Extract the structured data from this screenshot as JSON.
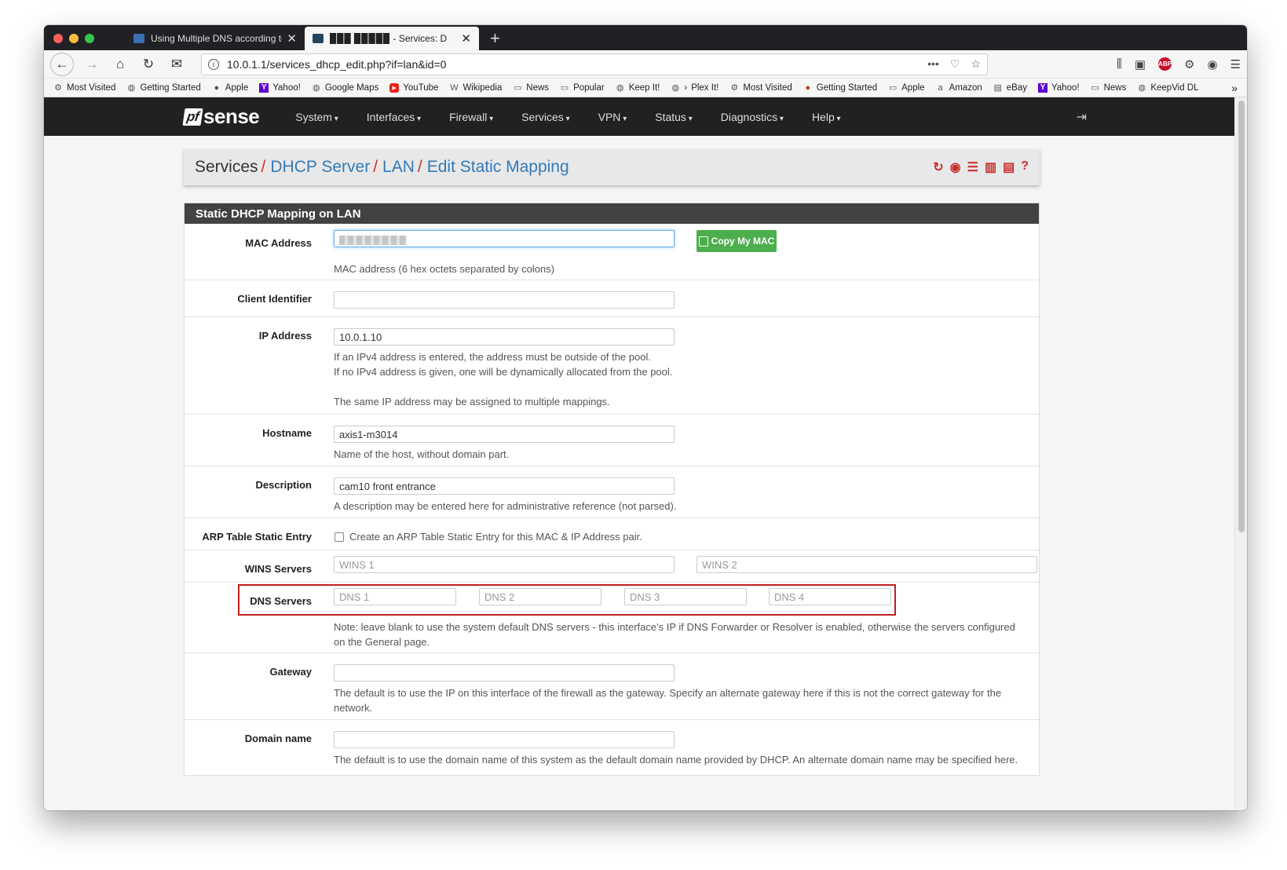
{
  "browser": {
    "tabs": [
      {
        "title": "Using Multiple DNS according to"
      },
      {
        "title": "▉▉▉ ▉▉▉▉▉ - Services: D"
      }
    ],
    "url": "10.0.1.1/services_dhcp_edit.php?if=lan&id=0",
    "bookmarks": [
      "Most Visited",
      "Getting Started",
      "Apple",
      "Yahoo!",
      "Google Maps",
      "YouTube",
      "Wikipedia",
      "News",
      "Popular",
      "Keep It!",
      "Plex It!",
      "Most Visited",
      "Getting Started",
      "Apple",
      "Amazon",
      "eBay",
      "Yahoo!",
      "News",
      "KeepVid DL"
    ]
  },
  "app": {
    "logo_pf": "pf",
    "logo_text": "sense",
    "menu": [
      "System",
      "Interfaces",
      "Firewall",
      "Services",
      "VPN",
      "Status",
      "Diagnostics",
      "Help"
    ]
  },
  "breadcrumb": {
    "root": "Services",
    "links": [
      "DHCP Server",
      "LAN",
      "Edit Static Mapping"
    ]
  },
  "panel": {
    "title": "Static DHCP Mapping on LAN"
  },
  "form": {
    "mac": {
      "label": "MAC Address",
      "button": "Copy My MAC",
      "help": "MAC address (6 hex octets separated by colons)"
    },
    "client_id": {
      "label": "Client Identifier",
      "value": ""
    },
    "ip": {
      "label": "IP Address",
      "value": "10.0.1.10",
      "help1": "If an IPv4 address is entered, the address must be outside of the pool.",
      "help2": "If no IPv4 address is given, one will be dynamically allocated from the pool.",
      "help3": "The same IP address may be assigned to multiple mappings."
    },
    "hostname": {
      "label": "Hostname",
      "value": "axis1-m3014",
      "help": "Name of the host, without domain part."
    },
    "description": {
      "label": "Description",
      "value": "cam10 front entrance",
      "help": "A description may be entered here for administrative reference (not parsed)."
    },
    "arp": {
      "label": "ARP Table Static Entry",
      "text": "Create an ARP Table Static Entry for this MAC & IP Address pair."
    },
    "wins": {
      "label": "WINS Servers",
      "ph1": "WINS 1",
      "ph2": "WINS 2"
    },
    "dns": {
      "label": "DNS Servers",
      "ph1": "DNS 1",
      "ph2": "DNS 2",
      "ph3": "DNS 3",
      "ph4": "DNS 4",
      "note1": "Note: leave blank to use the system default DNS servers - this interface's IP if DNS Forwarder or Resolver is enabled, otherwise the servers configured",
      "note2": "on the General page."
    },
    "gateway": {
      "label": "Gateway",
      "help1": "The default is to use the IP on this interface of the firewall as the gateway. Specify an alternate gateway here if this is not the correct gateway for the",
      "help2": "network."
    },
    "domain": {
      "label": "Domain name",
      "help": "The default is to use the domain name of this system as the default domain name provided by DHCP. An alternate domain name may be specified here."
    }
  },
  "colors": {
    "accent_red": "#c9302c",
    "link_blue": "#337ab7",
    "button_green": "#4cae4c",
    "highlight_border": "#c01f1f"
  }
}
